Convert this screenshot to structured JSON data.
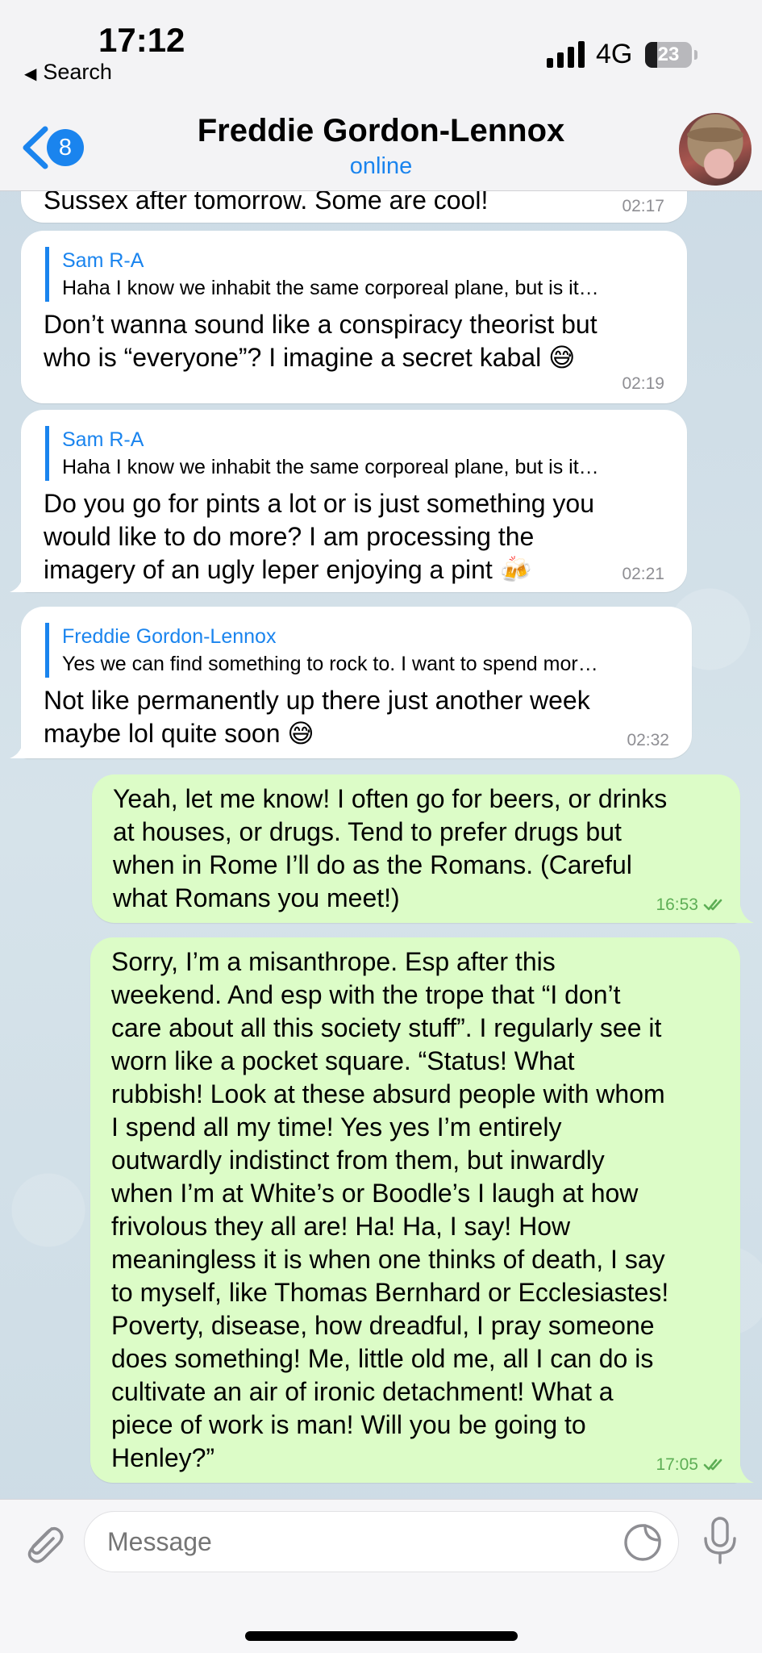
{
  "status_bar": {
    "time": "17:12",
    "back_app": "Search",
    "network": "4G",
    "battery": "23"
  },
  "header": {
    "unread_count": "8",
    "title": "Freddie Gordon-Lennox",
    "status": "online"
  },
  "messages": [
    {
      "direction": "incoming",
      "text": "Sussex after tomorrow. Some are cool!",
      "time": "02:17"
    },
    {
      "direction": "incoming",
      "reply_name": "Sam R-A",
      "reply_text": "Haha I know we inhabit the same corporeal plane, but is it…",
      "lines": [
        "Don’t wanna sound like a conspiracy theorist but",
        "who is “everyone”? I imagine a secret kabal 😅"
      ],
      "time": "02:19"
    },
    {
      "direction": "incoming",
      "reply_name": "Sam R-A",
      "reply_text": "Haha I know we inhabit the same corporeal plane, but is it…",
      "lines": [
        "Do you go for pints a lot or is just something you",
        "would like to do more? I am processing the",
        "imagery of an ugly leper enjoying a pint 🍻"
      ],
      "time": "02:21"
    },
    {
      "direction": "incoming",
      "reply_name": "Freddie Gordon-Lennox",
      "reply_text": "Yes we can find something to rock to. I want to spend mor…",
      "lines": [
        "Not like permanently up there just another week",
        "maybe lol quite soon 😅"
      ],
      "time": "02:32"
    },
    {
      "direction": "outgoing",
      "lines": [
        "Yeah, let me know! I often go for beers, or drinks",
        "at houses, or drugs. Tend to prefer drugs but",
        "when in Rome I’ll do as the Romans. (Careful",
        "what Romans you meet!)"
      ],
      "time": "16:53"
    },
    {
      "direction": "outgoing",
      "lines": [
        "Sorry, I’m a misanthrope. Esp after this",
        "weekend. And esp with the trope that “I don’t",
        "care about all this society stuff”. I regularly see it",
        "worn like a pocket square. “Status! What",
        "rubbish! Look at these absurd people with whom",
        "I spend all my time! Yes yes I’m entirely",
        "outwardly indistinct from them, but inwardly",
        "when I’m at White’s or Boodle’s I laugh at how",
        "frivolous they all are! Ha! Ha, I say! How",
        "meaningless it is when one thinks of death, I say",
        "to myself, like Thomas Bernhard or Ecclesiastes!",
        "Poverty, disease, how dreadful, I pray someone",
        "does something! Me, little old me, all I can do is",
        "cultivate an air of ironic detachment! What a",
        "piece of work is man! Will you be going to",
        "Henley?”"
      ],
      "time": "17:05"
    }
  ],
  "composer": {
    "placeholder": "Message"
  },
  "icons": {
    "back": "chevron-left-icon",
    "attach": "paperclip-icon",
    "sticker": "sticker-icon",
    "voice": "microphone-icon"
  },
  "colors": {
    "accent": "#1a84ee",
    "outgoing_bubble": "#dcfcc7",
    "incoming_bubble": "#ffffff",
    "read_tick": "#5dae55"
  }
}
